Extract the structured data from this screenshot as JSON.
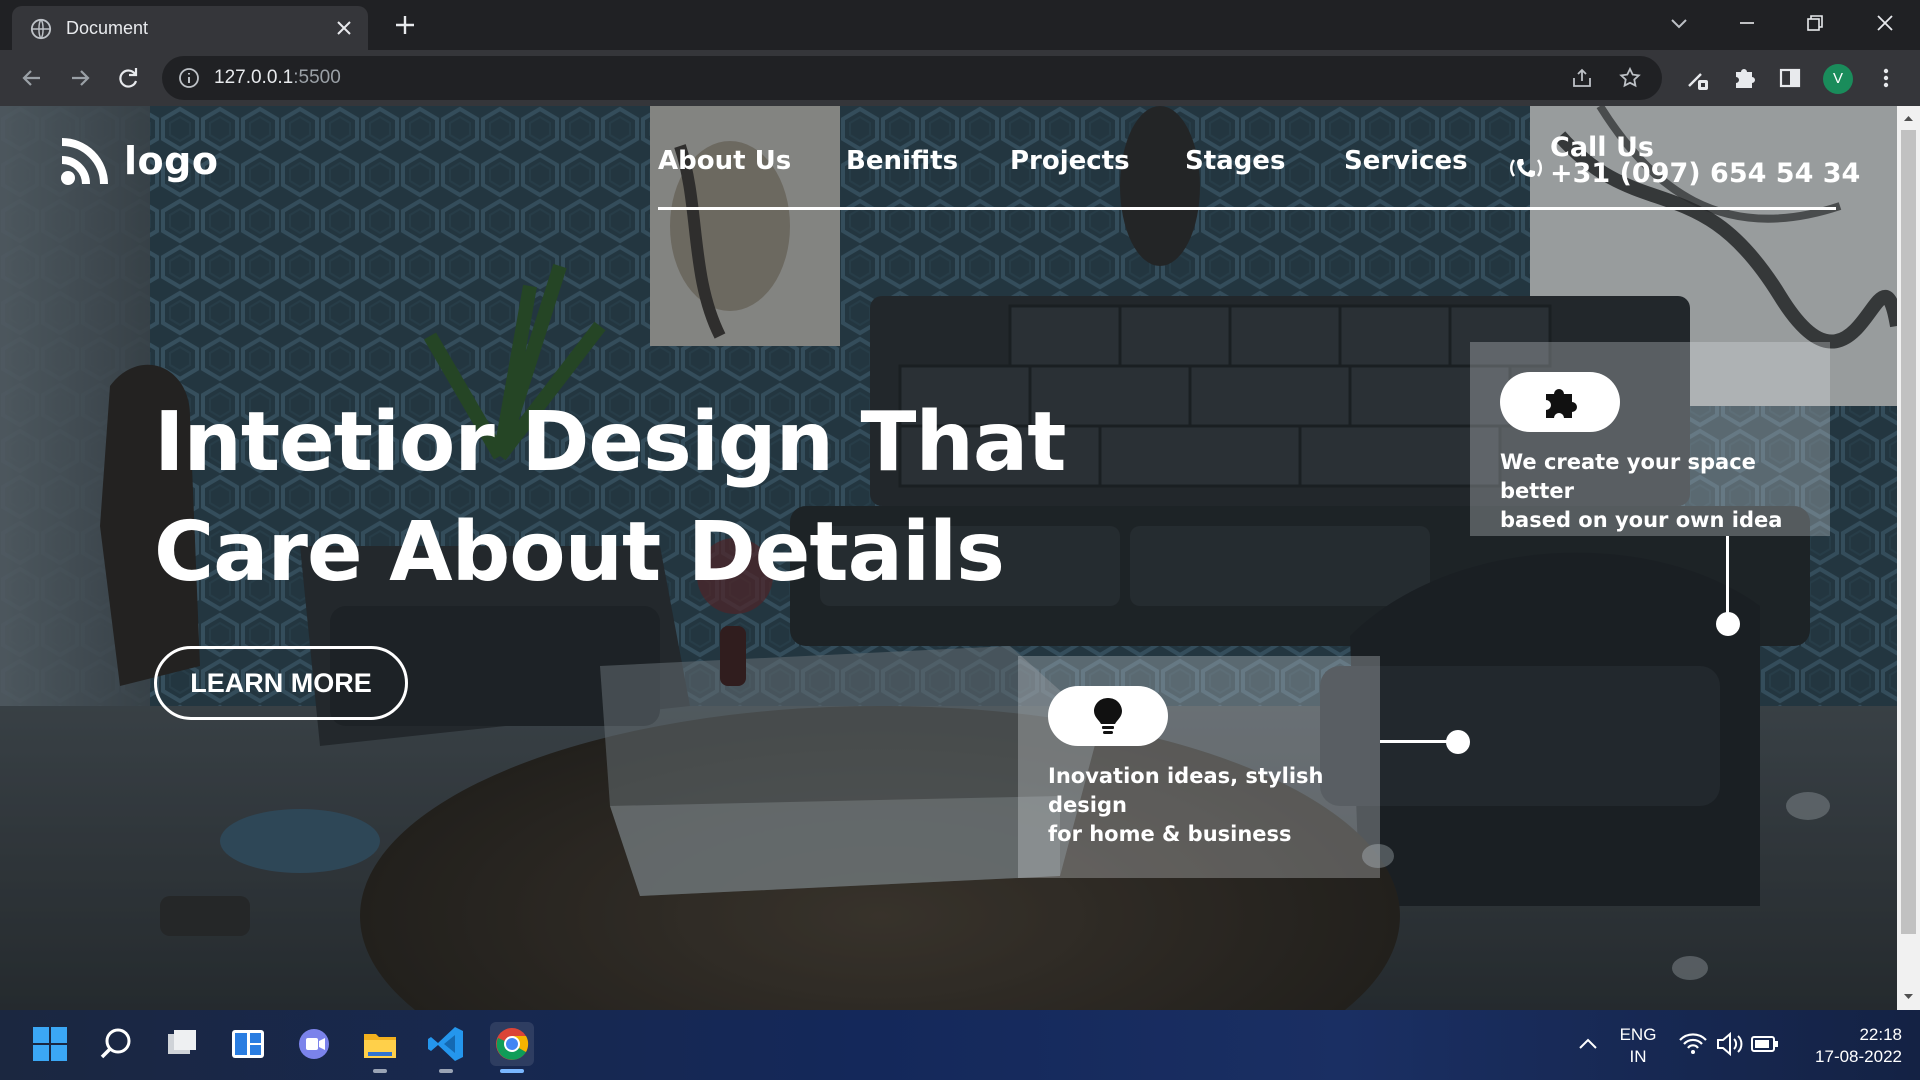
{
  "browser": {
    "tab_title": "Document",
    "url_host": "127.0.0.1",
    "url_port": ":5500",
    "profile_initial": "V"
  },
  "site": {
    "logo_text": "logo",
    "nav": [
      {
        "label": "About Us"
      },
      {
        "label": "Benifits"
      },
      {
        "label": "Projects"
      },
      {
        "label": "Stages"
      },
      {
        "label": "Services"
      }
    ],
    "call_title": "Call Us",
    "call_number": "+31 (097) 654 54 34",
    "hero_line1": "Intetior Design That",
    "hero_line2": "Care About Details",
    "cta_label": "LEARN MORE",
    "card1_text_line1": "We create your space better",
    "card1_text_line2": "based on your own idea",
    "card1_icon": "puzzle-icon",
    "card2_text_line1": "Inovation ideas, stylish",
    "card2_text_line2": "design",
    "card2_text_line3": "for home & business",
    "card2_icon": "lightbulb-icon"
  },
  "taskbar": {
    "language": "ENG",
    "region": "IN",
    "time": "22:18",
    "date": "17-08-2022"
  },
  "colors": {
    "accent_white": "#ffffff",
    "chrome_dark": "#202124",
    "chrome_toolbar": "#35363a",
    "avatar": "#1a8c5b"
  }
}
